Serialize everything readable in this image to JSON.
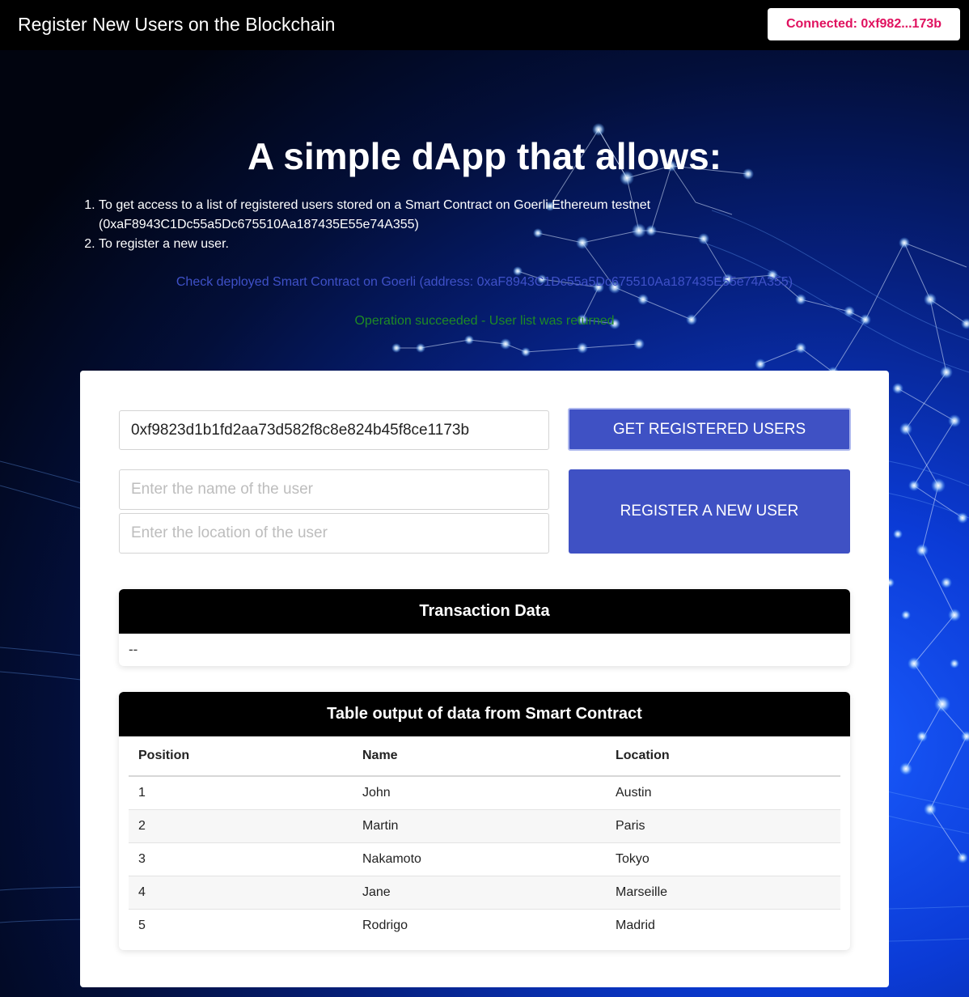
{
  "navbar": {
    "title": "Register New Users on the Blockchain",
    "connect_label": "Connected: 0xf982...173b"
  },
  "hero": {
    "headline": "A simple dApp that allows:",
    "items": [
      "To get access to a list of registered users stored on a Smart Contract on Goerli Ethereum testnet (0xaF8943C1Dc55a5Dc675510Aa187435E55e74A355)",
      "To register a new user."
    ],
    "contract_link": "Check deployed Smart Contract on Goerli (address: 0xaF8943C1Dc55a5Dc675510Aa187435E55e74A355)",
    "status_message": "Operation succeeded - User list was returned"
  },
  "form": {
    "address_value": "0xf9823d1b1fd2aa73d582f8c8e824b45f8ce1173b",
    "get_users_label": "GET REGISTERED USERS",
    "name_placeholder": "Enter the name of the user",
    "location_placeholder": "Enter the location of the user",
    "register_label": "REGISTER A NEW USER"
  },
  "transaction": {
    "header": "Transaction Data",
    "value": "--"
  },
  "users_table": {
    "header": "Table output of data from Smart Contract",
    "columns": [
      "Position",
      "Name",
      "Location"
    ],
    "rows": [
      [
        "1",
        "John",
        "Austin"
      ],
      [
        "2",
        "Martin",
        "Paris"
      ],
      [
        "3",
        "Nakamoto",
        "Tokyo"
      ],
      [
        "4",
        "Jane",
        "Marseille"
      ],
      [
        "5",
        "Rodrigo",
        "Madrid"
      ]
    ]
  },
  "colors": {
    "accent": "#3f51c4",
    "connect_text": "#e0115f",
    "success": "#1e8a25",
    "link": "#3f51c8"
  }
}
